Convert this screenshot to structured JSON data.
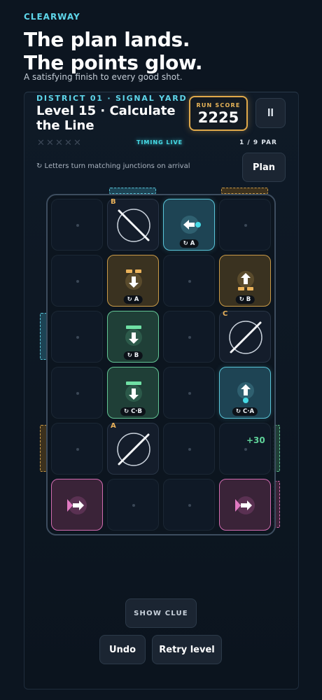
{
  "app": {
    "brand": "CLEARWAY"
  },
  "hero": {
    "headline_line1": "The plan lands.",
    "headline_line2": "The points glow.",
    "tagline": "A satisfying finish to every good shot."
  },
  "level": {
    "district": "DISTRICT 01 · SIGNAL YARD",
    "title": "Level 15 · Calculate the Line",
    "timing_status": "TIMING LIVE",
    "par": "1 / 9 PAR",
    "stars_earned": 0,
    "stars_total": 5
  },
  "score": {
    "label": "RUN SCORE",
    "value": "2225"
  },
  "controls": {
    "pause_label": "II",
    "plan_label": "Plan",
    "hint": "↻ Letters turn matching junctions on arrival",
    "show_clue_label": "SHOW CLUE",
    "undo_label": "Undo",
    "retry_label": "Retry level"
  },
  "board": {
    "rows": 6,
    "cols": 4,
    "tiles": [
      {
        "row": 0,
        "col": 1,
        "type": "mirror",
        "orientation": "backslash",
        "letter": "B"
      },
      {
        "row": 0,
        "col": 2,
        "type": "emitter-left",
        "color": "blue",
        "tag": "↻ A"
      },
      {
        "row": 1,
        "col": 1,
        "type": "arrow-down",
        "color": "gold",
        "tag": "↻ A"
      },
      {
        "row": 1,
        "col": 3,
        "type": "arrow-up",
        "color": "gold",
        "tag": "↻ B"
      },
      {
        "row": 2,
        "col": 1,
        "type": "arrow-down",
        "color": "green",
        "tag": "↻ B"
      },
      {
        "row": 2,
        "col": 3,
        "type": "mirror",
        "orientation": "slash",
        "letter": "C"
      },
      {
        "row": 3,
        "col": 1,
        "type": "arrow-down",
        "color": "green",
        "tag": "↻ C·B"
      },
      {
        "row": 3,
        "col": 3,
        "type": "arrow-up",
        "color": "blue",
        "tag": "↻ C·A"
      },
      {
        "row": 4,
        "col": 1,
        "type": "mirror",
        "orientation": "slash",
        "letter": "A"
      },
      {
        "row": 4,
        "col": 3,
        "type": "bonus",
        "bonus": "+30"
      },
      {
        "row": 5,
        "col": 0,
        "type": "launcher-right",
        "color": "pink"
      },
      {
        "row": 5,
        "col": 3,
        "type": "launcher-right",
        "color": "pink"
      }
    ]
  },
  "colors": {
    "accent": "#5ed6ea",
    "score_border": "#e0a94a",
    "tile_blue": "#59c4d8",
    "tile_gold": "#c99a47",
    "tile_green": "#63c595",
    "tile_pink": "#d26cb0",
    "bonus": "#5fd39a"
  }
}
